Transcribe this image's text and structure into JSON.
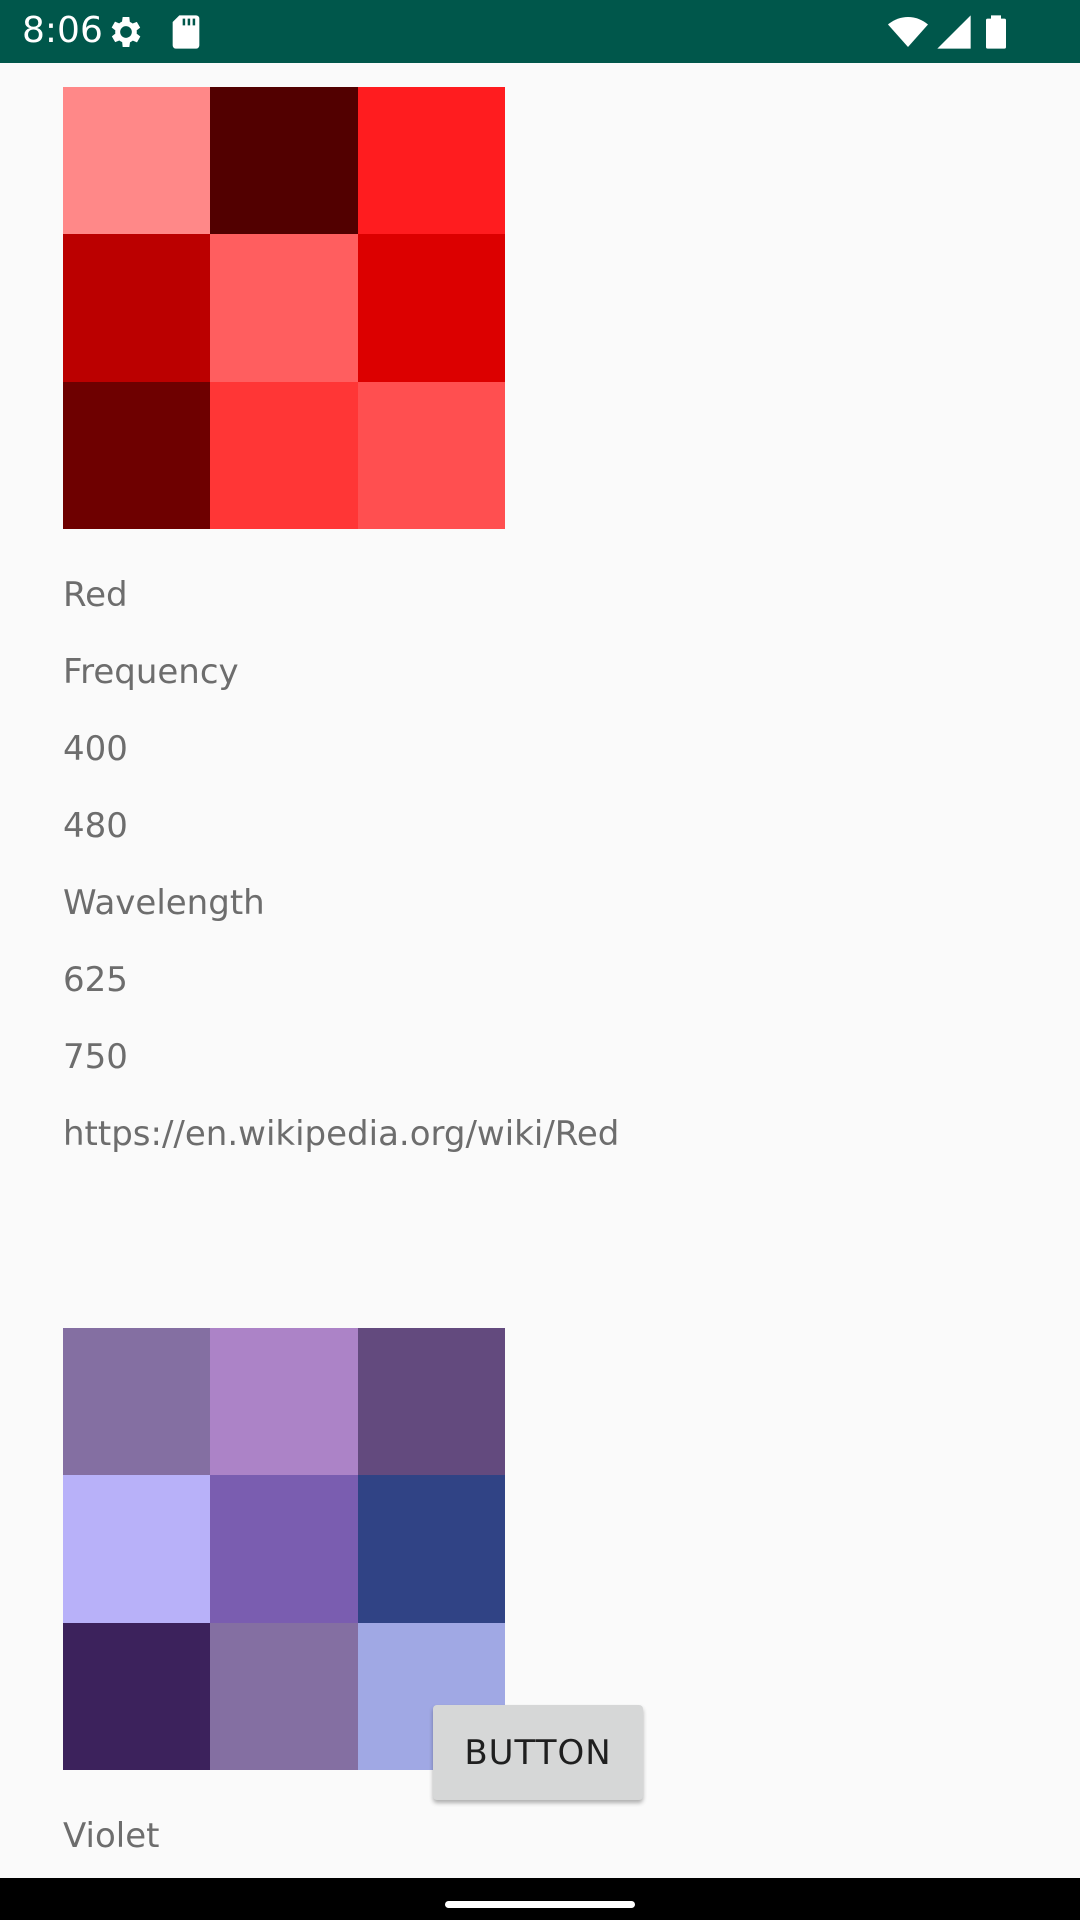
{
  "status_bar": {
    "time": "8:06",
    "background": "#00574b",
    "left_icons": [
      "settings-icon",
      "sd-card-icon"
    ],
    "right_icons": [
      "wifi-icon",
      "cell-signal-icon",
      "battery-icon"
    ]
  },
  "colors": [
    {
      "swatches": [
        "#ff8888",
        "#520000",
        "#ff1c1f",
        "#bb0000",
        "#ff5e5f",
        "#dc0000",
        "#6e0000",
        "#ff3636",
        "#ff4f50"
      ],
      "name": "Red",
      "frequency_label": "Frequency",
      "frequency_min": "400",
      "frequency_max": "480",
      "wavelength_label": "Wavelength",
      "wavelength_min": "625",
      "wavelength_max": "750",
      "url": "https://en.wikipedia.org/wiki/Red"
    },
    {
      "swatches": [
        "#846fa2",
        "#ac83c7",
        "#634a7e",
        "#b8b1f9",
        "#7a5db0",
        "#304385",
        "#3c225c",
        "#846fa2",
        "#a0a8e4"
      ],
      "name": "Violet"
    }
  ],
  "button": {
    "label": "BUTTON"
  }
}
